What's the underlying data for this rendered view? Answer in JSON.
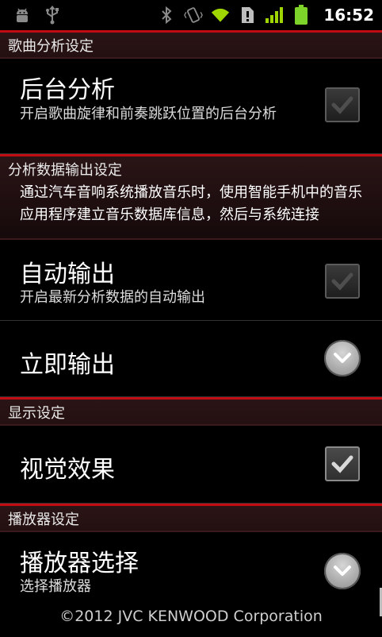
{
  "status_bar": {
    "icons_left": [
      "android-debug-icon",
      "usb-icon"
    ],
    "icons_right": [
      "bluetooth-icon",
      "vibrate-icon",
      "wifi-icon",
      "alert-icon",
      "signal-icon",
      "battery-icon"
    ],
    "time": "16:52"
  },
  "sections": {
    "song_analysis": {
      "header": "歌曲分析设定",
      "background_analysis": {
        "title": "后台分析",
        "summary": "开启歌曲旋律和前奏跳跃位置的后台分析",
        "checked": false
      }
    },
    "data_output": {
      "header": "分析数据输出设定",
      "description": "通过汽车音响系统播放音乐时，使用智能手机中的音乐应用程序建立音乐数据库信息，然后与系统连接",
      "auto_output": {
        "title": "自动输出",
        "summary": "开启最新分析数据的自动输出",
        "checked": false
      },
      "immediate_output": {
        "title": "立即输出"
      }
    },
    "display": {
      "header": "显示设定",
      "visual_effect": {
        "title": "视觉效果",
        "checked": true
      }
    },
    "player": {
      "header": "播放器设定",
      "player_select": {
        "title": "播放器选择",
        "summary": "选择播放器"
      }
    }
  },
  "footer": "©2012 JVC KENWOOD Corporation",
  "colors": {
    "accent_red": "#c00c12",
    "background": "#000000",
    "header_bg": "#2a1416",
    "wifi_green": "#9fd500",
    "battery_green": "#7ed32a"
  }
}
